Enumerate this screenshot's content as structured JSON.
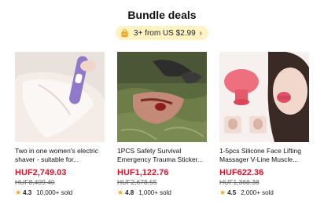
{
  "header": {
    "title": "Bundle deals"
  },
  "promo": {
    "label": "3+ from US $2.99",
    "icon": "shopping-bag-icon"
  },
  "products": [
    {
      "name": "Two in one women's electric shaver - suitable for...",
      "price": "HUF2,749.03",
      "old_price": "HUF8,409.40",
      "rating": "4.3",
      "sold": "10,000+ sold"
    },
    {
      "name": "1PCS Safety Survival Emergency Trauma Sticker...",
      "price": "HUF1,122.76",
      "old_price": "HUF2,678.55",
      "rating": "4.8",
      "sold": "1,000+ sold"
    },
    {
      "name": "1-5pcs Silicone Face Lifting Massager V-Line Muscle...",
      "price": "HUF622.36",
      "old_price": "HUF1,368.38",
      "rating": "4.5",
      "sold": "2,000+ sold"
    }
  ],
  "colors": {
    "price": "#e0102a",
    "pill_bg": "#fff3c4",
    "star": "#f5a623"
  }
}
